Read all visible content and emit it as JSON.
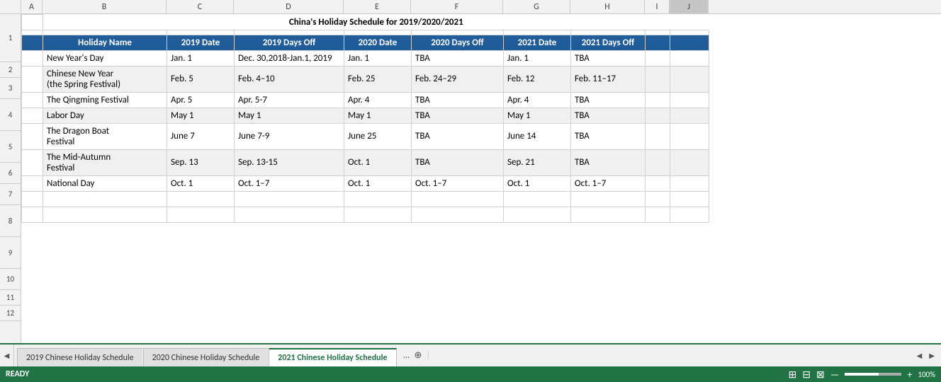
{
  "title": "China's Holiday Schedule for 2019/2020/2021",
  "columns": {
    "letters": [
      "A",
      "B",
      "C",
      "D",
      "E",
      "F",
      "G",
      "H",
      "I",
      "J"
    ],
    "widths": [
      30,
      175,
      95,
      155,
      95,
      130,
      95,
      105,
      35,
      55
    ]
  },
  "rows": {
    "numbers": [
      "1",
      "2",
      "3",
      "4",
      "5",
      "6",
      "7",
      "8",
      "9",
      "10",
      "11",
      "12"
    ],
    "heights": [
      68,
      22,
      30,
      45,
      45,
      30,
      30,
      45,
      45,
      30,
      22,
      22
    ]
  },
  "headers": {
    "col1": "Holiday Name",
    "col2": "2019 Date",
    "col3": "2019 Days Off",
    "col4": "2020 Date",
    "col5": "2020 Days Off",
    "col6": "2021 Date",
    "col7": "2021 Days Off"
  },
  "data": [
    {
      "name": "New Year's Day",
      "date2019": "Jan. 1",
      "daysoff2019": "Dec. 30,2018-Jan.1, 2019",
      "date2020": "Jan. 1",
      "daysoff2020": "TBA",
      "date2021": "Jan. 1",
      "daysoff2021": "TBA"
    },
    {
      "name": "Chinese New Year\n(the Spring Festival)",
      "date2019": "Feb. 5",
      "daysoff2019": "Feb. 4–10",
      "date2020": "Feb. 25",
      "daysoff2020": "Feb. 24–29",
      "date2021": "Feb. 12",
      "daysoff2021": "Feb. 11–17"
    },
    {
      "name": "The Qingming Festival",
      "date2019": "Apr. 5",
      "daysoff2019": "Apr. 5-7",
      "date2020": "Apr. 4",
      "daysoff2020": "TBA",
      "date2021": "Apr. 4",
      "daysoff2021": "TBA"
    },
    {
      "name": "Labor Day",
      "date2019": "May 1",
      "daysoff2019": "May 1",
      "date2020": "May 1",
      "daysoff2020": "TBA",
      "date2021": "May 1",
      "daysoff2021": "TBA"
    },
    {
      "name": "The Dragon Boat\nFestival",
      "date2019": "June 7",
      "daysoff2019": "June 7-9",
      "date2020": "June 25",
      "daysoff2020": "TBA",
      "date2021": "June 14",
      "daysoff2021": "TBA"
    },
    {
      "name": "The Mid-Autumn\nFestival",
      "date2019": "Sep. 13",
      "daysoff2019": "Sep. 13-15",
      "date2020": "Oct. 1",
      "daysoff2020": "TBA",
      "date2021": "Sep. 21",
      "daysoff2021": "TBA"
    },
    {
      "name": "National Day",
      "date2019": "Oct. 1",
      "daysoff2019": "Oct. 1–7",
      "date2020": "Oct. 1",
      "daysoff2020": "Oct. 1–7",
      "date2021": "Oct. 1",
      "daysoff2021": "Oct. 1–7"
    }
  ],
  "tabs": [
    {
      "label": "2019 Chinese Holiday Schedule",
      "active": false
    },
    {
      "label": "2020 Chinese Holiday Schedule",
      "active": false
    },
    {
      "label": "2021 Chinese Holiday Schedule",
      "active": true
    }
  ],
  "status": {
    "ready": "READY",
    "zoom": "100%"
  }
}
